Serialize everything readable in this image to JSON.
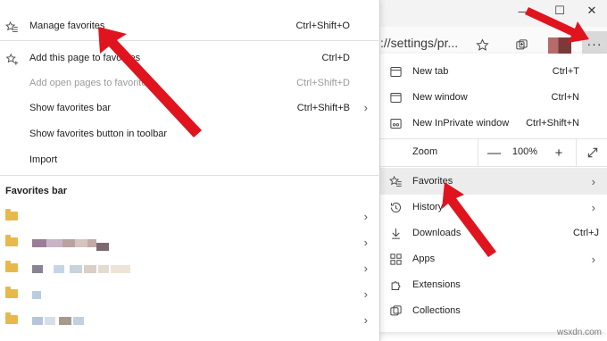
{
  "window": {
    "minimize_glyph": "—",
    "maximize_glyph": "☐",
    "close_glyph": "✕"
  },
  "toolbar": {
    "address_text": "://settings/pr...",
    "favorite_star_icon": "star-icon",
    "collections_icon": "collections-icon",
    "more_glyph": "···"
  },
  "favorites_panel": {
    "items": [
      {
        "label": "Manage favorites",
        "shortcut": "Ctrl+Shift+O",
        "enabled": true
      },
      {
        "label": "Add this page to favorites",
        "shortcut": "Ctrl+D",
        "enabled": true
      },
      {
        "label": "Add open pages to favorites",
        "shortcut": "Ctrl+Shift+D",
        "enabled": false
      },
      {
        "label": "Show favorites bar",
        "shortcut": "Ctrl+Shift+B",
        "enabled": true
      },
      {
        "label": "Show favorites button in toolbar",
        "shortcut": "",
        "enabled": true
      },
      {
        "label": "Import",
        "shortcut": "",
        "enabled": true
      }
    ],
    "bar_heading": "Favorites bar"
  },
  "main_menu": {
    "new_tab": {
      "label": "New tab",
      "shortcut": "Ctrl+T"
    },
    "new_window": {
      "label": "New window",
      "shortcut": "Ctrl+N"
    },
    "new_inprivate": {
      "label": "New InPrivate window",
      "shortcut": "Ctrl+Shift+N"
    },
    "zoom": {
      "label": "Zoom",
      "minus": "—",
      "value": "100%",
      "plus": "+"
    },
    "favorites": {
      "label": "Favorites"
    },
    "history": {
      "label": "History"
    },
    "downloads": {
      "label": "Downloads",
      "shortcut": "Ctrl+J"
    },
    "apps": {
      "label": "Apps"
    },
    "extensions": {
      "label": "Extensions"
    },
    "collections": {
      "label": "Collections"
    }
  },
  "colors": {
    "annotation_arrow": "#e0141e",
    "folder": "#e8b94a",
    "hover_row": "#ececec"
  },
  "watermark": "wsxdn.com"
}
